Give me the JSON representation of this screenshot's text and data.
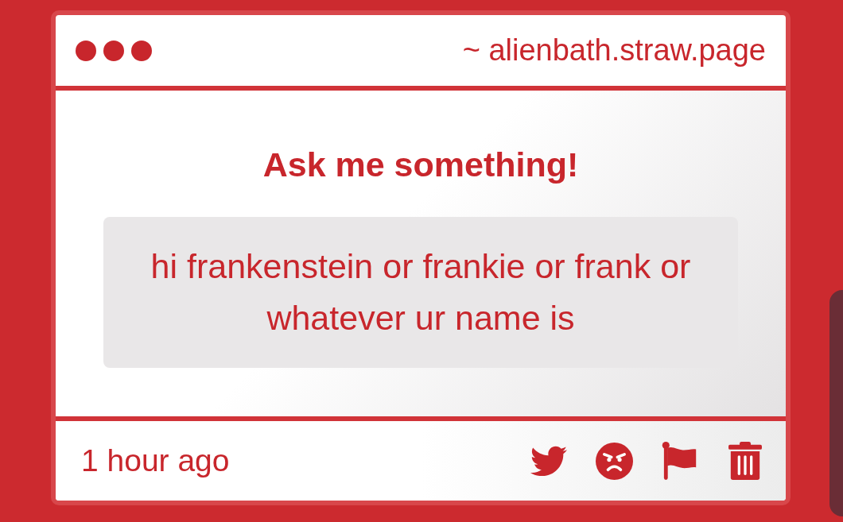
{
  "window": {
    "url": "~ alienbath.straw.page"
  },
  "prompt": {
    "title": "Ask me something!"
  },
  "question": {
    "text": "hi frankenstein or frankie or frank or whatever ur name is"
  },
  "footer": {
    "time": "1 hour ago",
    "actions": [
      {
        "kind": "bird"
      },
      {
        "kind": "angry-face"
      },
      {
        "kind": "flag"
      },
      {
        "kind": "trash"
      }
    ]
  }
}
